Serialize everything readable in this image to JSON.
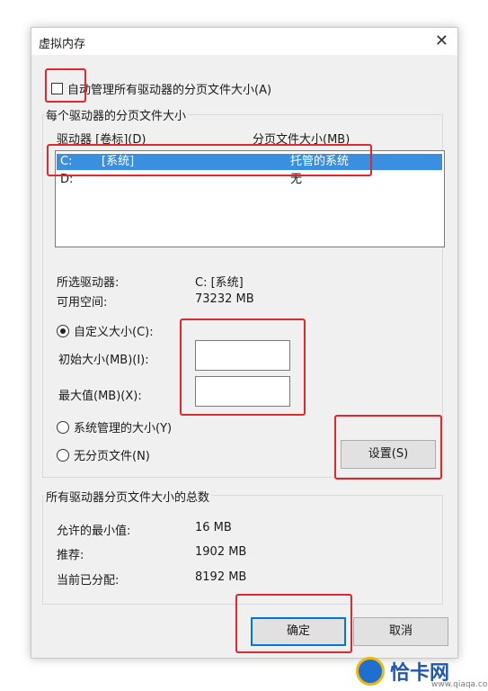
{
  "dialog": {
    "title": "虚拟内存",
    "close_symbol": "✕"
  },
  "auto_manage": {
    "label": "自动管理所有驱动器的分页文件大小(A)",
    "checked": false
  },
  "per_drive": {
    "group_title": "每个驱动器的分页文件大小",
    "header_drive": "驱动器 [卷标](D)",
    "header_size": "分页文件大小(MB)",
    "rows": [
      {
        "drive": "C:",
        "volume": "[系统]",
        "size": "托管的系统",
        "selected": true
      },
      {
        "drive": "D:",
        "volume": "",
        "size": "无",
        "selected": false
      }
    ],
    "selected_drive_label": "所选驱动器:",
    "selected_drive_value": "C:  [系统]",
    "free_space_label": "可用空间:",
    "free_space_value": "73232 MB",
    "custom_size_label": "自定义大小(C):",
    "initial_size_label": "初始大小(MB)(I):",
    "initial_size_value": "",
    "max_size_label": "最大值(MB)(X):",
    "max_size_value": "",
    "system_managed_label": "系统管理的大小(Y)",
    "no_paging_label": "无分页文件(N)",
    "set_button": "设置(S)"
  },
  "totals": {
    "group_title": "所有驱动器分页文件大小的总数",
    "min_allowed_label": "允许的最小值:",
    "min_allowed_value": "16 MB",
    "recommended_label": "推荐:",
    "recommended_value": "1902 MB",
    "current_label": "当前已分配:",
    "current_value": "8192 MB"
  },
  "buttons": {
    "ok": "确定",
    "cancel": "取消"
  },
  "watermark": {
    "text": "恰卡网",
    "url": "www.qiaqa.com"
  },
  "colors": {
    "highlight": "#3b8fe0",
    "annotation_red": "#e0282e",
    "default_button_border": "#0078d7"
  }
}
